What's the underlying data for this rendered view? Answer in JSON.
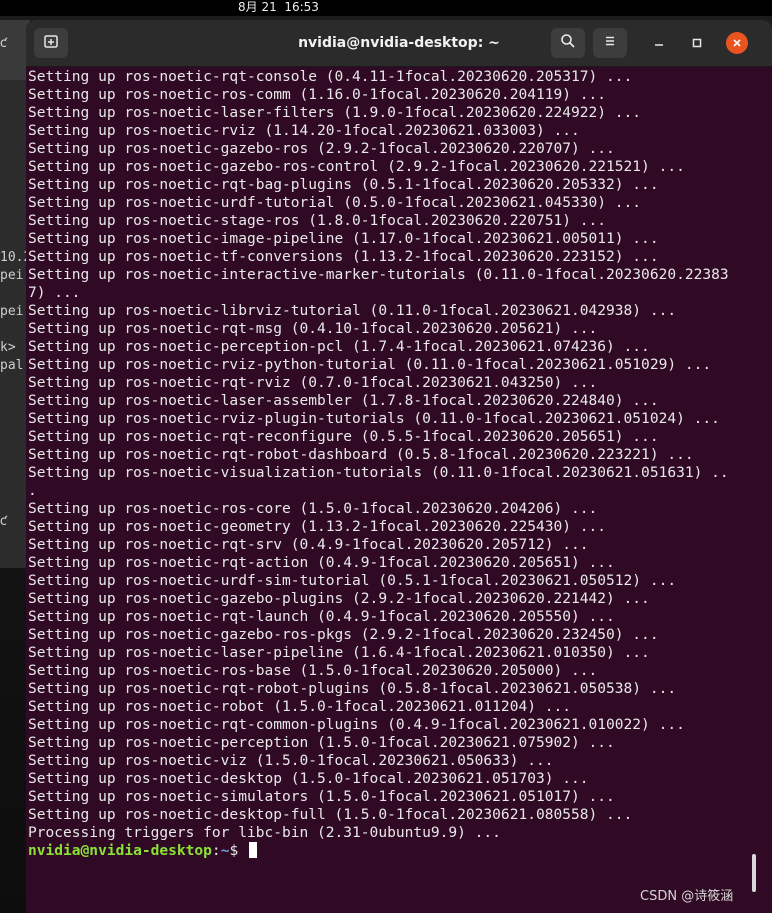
{
  "system_bar": {
    "clock": "8月 21  16:53"
  },
  "background_window": {
    "fragments": [
      "ƈ",
      "10.2",
      "pei",
      "pei",
      "k>",
      "pal:",
      "ƈ"
    ]
  },
  "window": {
    "title": "nvidia@nvidia-desktop: ~",
    "icons": {
      "new_tab": "new-tab-icon",
      "search": "search-icon",
      "menu": "hamburger-menu-icon",
      "minimize": "minimize-icon",
      "maximize": "maximize-icon",
      "close": "close-icon"
    },
    "colors": {
      "terminal_bg": "#300a24",
      "header_bg": "#2b2b2b",
      "close_accent": "#e95420",
      "prompt_user": "#8ae234",
      "prompt_path": "#729fcf"
    }
  },
  "terminal": {
    "lines": [
      "Setting up ros-noetic-rqt-console (0.4.11-1focal.20230620.205317) ...",
      "Setting up ros-noetic-ros-comm (1.16.0-1focal.20230620.204119) ...",
      "Setting up ros-noetic-laser-filters (1.9.0-1focal.20230620.224922) ...",
      "Setting up ros-noetic-rviz (1.14.20-1focal.20230621.033003) ...",
      "Setting up ros-noetic-gazebo-ros (2.9.2-1focal.20230620.220707) ...",
      "Setting up ros-noetic-gazebo-ros-control (2.9.2-1focal.20230620.221521) ...",
      "Setting up ros-noetic-rqt-bag-plugins (0.5.1-1focal.20230620.205332) ...",
      "Setting up ros-noetic-urdf-tutorial (0.5.0-1focal.20230621.045330) ...",
      "Setting up ros-noetic-stage-ros (1.8.0-1focal.20230620.220751) ...",
      "Setting up ros-noetic-image-pipeline (1.17.0-1focal.20230621.005011) ...",
      "Setting up ros-noetic-tf-conversions (1.13.2-1focal.20230620.223152) ...",
      "Setting up ros-noetic-interactive-marker-tutorials (0.11.0-1focal.20230620.22383",
      "7) ...",
      "Setting up ros-noetic-librviz-tutorial (0.11.0-1focal.20230621.042938) ...",
      "Setting up ros-noetic-rqt-msg (0.4.10-1focal.20230620.205621) ...",
      "Setting up ros-noetic-perception-pcl (1.7.4-1focal.20230621.074236) ...",
      "Setting up ros-noetic-rviz-python-tutorial (0.11.0-1focal.20230621.051029) ...",
      "Setting up ros-noetic-rqt-rviz (0.7.0-1focal.20230621.043250) ...",
      "Setting up ros-noetic-laser-assembler (1.7.8-1focal.20230620.224840) ...",
      "Setting up ros-noetic-rviz-plugin-tutorials (0.11.0-1focal.20230621.051024) ...",
      "Setting up ros-noetic-rqt-reconfigure (0.5.5-1focal.20230620.205651) ...",
      "Setting up ros-noetic-rqt-robot-dashboard (0.5.8-1focal.20230620.223221) ...",
      "Setting up ros-noetic-visualization-tutorials (0.11.0-1focal.20230621.051631) ..",
      ".",
      "Setting up ros-noetic-ros-core (1.5.0-1focal.20230620.204206) ...",
      "Setting up ros-noetic-geometry (1.13.2-1focal.20230620.225430) ...",
      "Setting up ros-noetic-rqt-srv (0.4.9-1focal.20230620.205712) ...",
      "Setting up ros-noetic-rqt-action (0.4.9-1focal.20230620.205651) ...",
      "Setting up ros-noetic-urdf-sim-tutorial (0.5.1-1focal.20230621.050512) ...",
      "Setting up ros-noetic-gazebo-plugins (2.9.2-1focal.20230620.221442) ...",
      "Setting up ros-noetic-rqt-launch (0.4.9-1focal.20230620.205550) ...",
      "Setting up ros-noetic-gazebo-ros-pkgs (2.9.2-1focal.20230620.232450) ...",
      "Setting up ros-noetic-laser-pipeline (1.6.4-1focal.20230621.010350) ...",
      "Setting up ros-noetic-ros-base (1.5.0-1focal.20230620.205000) ...",
      "Setting up ros-noetic-rqt-robot-plugins (0.5.8-1focal.20230621.050538) ...",
      "Setting up ros-noetic-robot (1.5.0-1focal.20230621.011204) ...",
      "Setting up ros-noetic-rqt-common-plugins (0.4.9-1focal.20230621.010022) ...",
      "Setting up ros-noetic-perception (1.5.0-1focal.20230621.075902) ...",
      "Setting up ros-noetic-viz (1.5.0-1focal.20230621.050633) ...",
      "Setting up ros-noetic-desktop (1.5.0-1focal.20230621.051703) ...",
      "Setting up ros-noetic-simulators (1.5.0-1focal.20230621.051017) ...",
      "Setting up ros-noetic-desktop-full (1.5.0-1focal.20230621.080558) ...",
      "Processing triggers for libc-bin (2.31-0ubuntu9.9) ..."
    ],
    "prompt": {
      "user_host": "nvidia@nvidia-desktop",
      "separator": ":",
      "path": "~",
      "symbol": "$"
    }
  },
  "watermark": "CSDN @诗筱涵"
}
